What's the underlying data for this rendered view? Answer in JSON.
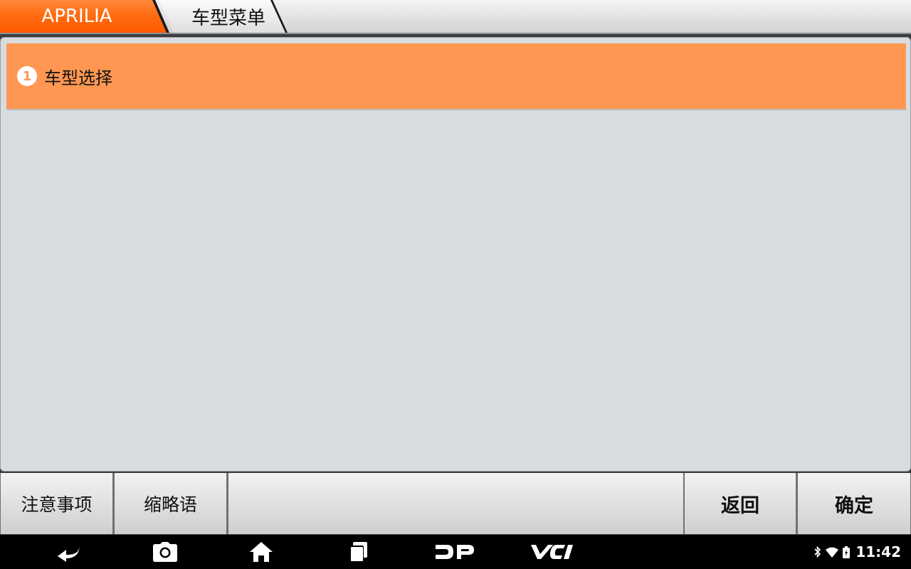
{
  "header": {
    "breadcrumbs": [
      {
        "label": "APRILIA"
      },
      {
        "label": "车型菜单"
      }
    ]
  },
  "menu": {
    "items": [
      {
        "number": "1",
        "label": "车型选择"
      }
    ]
  },
  "footer": {
    "notes_label": "注意事项",
    "abbr_label": "缩略语",
    "back_label": "返回",
    "ok_label": "确定"
  },
  "navbar": {
    "icons": [
      "back-icon",
      "camera-icon",
      "home-icon",
      "recent-apps-icon",
      "dp-icon",
      "vci-icon"
    ]
  },
  "status": {
    "icons": [
      "bluetooth-icon",
      "wifi-icon",
      "battery-icon"
    ],
    "time": "11:42"
  },
  "colors": {
    "accent": "#ff6a10",
    "selected_item": "#ff9753",
    "panel": "#d8dcdf"
  }
}
